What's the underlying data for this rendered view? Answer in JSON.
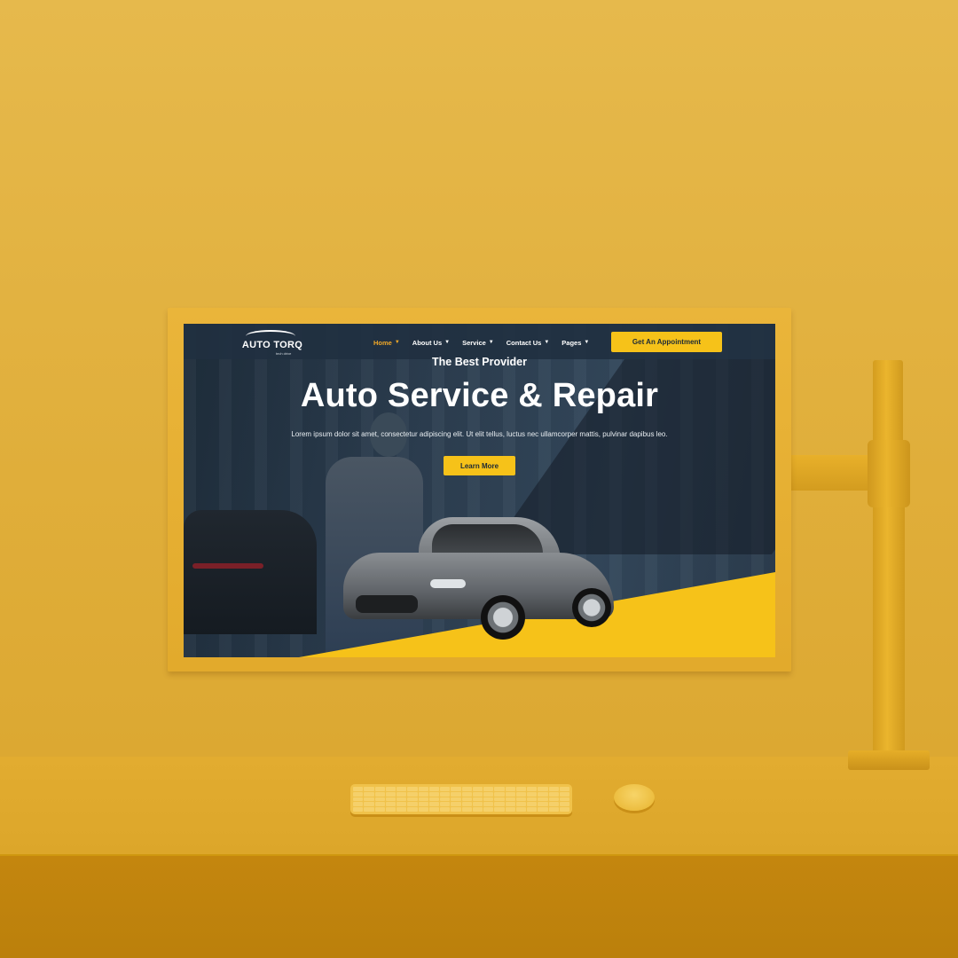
{
  "header": {
    "logo": {
      "name": "AUTO TORQ",
      "tagline": "tech drive"
    },
    "menu": [
      {
        "label": "Home",
        "active": true
      },
      {
        "label": "About Us",
        "active": false
      },
      {
        "label": "Service",
        "active": false
      },
      {
        "label": "Contact Us",
        "active": false
      },
      {
        "label": "Pages",
        "active": false
      }
    ],
    "cta_label": "Get An Appointment"
  },
  "hero": {
    "subtitle": "The Best Provider",
    "title": "Auto Service & Repair",
    "text": "Lorem ipsum dolor sit amet, consectetur adipiscing elit. Ut elit tellus, luctus nec ullamcorper mattis, pulvinar dapibus leo.",
    "button_label": "Learn More"
  },
  "icons": {
    "menu_chevron": "chevron-down-icon",
    "logo": "car-silhouette-icon"
  },
  "colors": {
    "accent": "#f6c219",
    "nav_bg": "#203040",
    "active_menu": "#f0a828",
    "scene_bg": "#e0ae3a"
  }
}
